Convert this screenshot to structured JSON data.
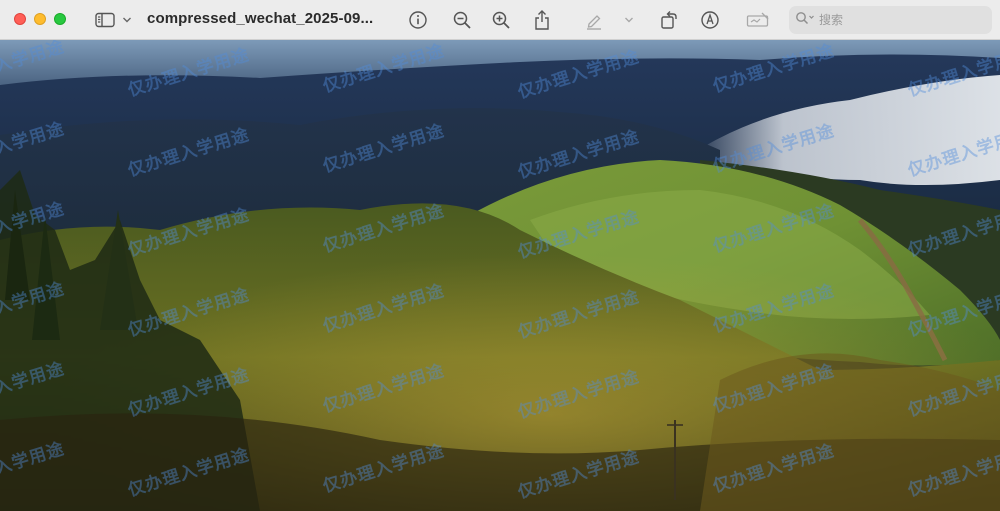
{
  "window": {
    "title": "compressed_wechat_2025-09..."
  },
  "search": {
    "placeholder": "搜索"
  },
  "watermark": {
    "text": "仅办理入学用途"
  },
  "toolbar_icons": [
    "sidebar-icon",
    "chevron-down-icon",
    "info-icon",
    "zoom-out-icon",
    "zoom-in-icon",
    "share-icon",
    "markup-pen-icon",
    "chevron-down-icon",
    "rotate-icon",
    "markup-icon",
    "signature-icon",
    "search-icon"
  ],
  "colors": {
    "close": "#ff5f57",
    "minimize": "#febc2e",
    "maximize": "#28c840",
    "watermark": "#508cdc"
  }
}
